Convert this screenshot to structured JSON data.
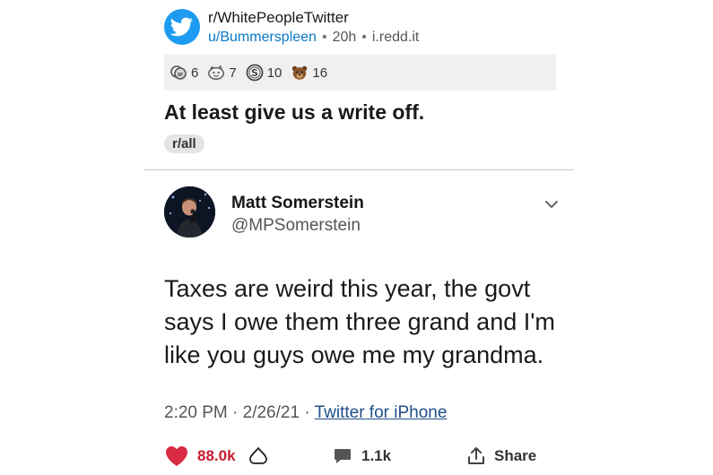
{
  "post": {
    "subreddit": "r/WhitePeopleTwitter",
    "user": "u/Bummerspleen",
    "age": "20h",
    "domain": "i.redd.it",
    "awards": [
      {
        "icon": "silver-award-icon",
        "count": "6"
      },
      {
        "icon": "wholesome-award-icon",
        "count": "7"
      },
      {
        "icon": "coin-award-icon",
        "count": "10"
      },
      {
        "icon": "bear-award-icon",
        "count": "16"
      }
    ],
    "title": "At least give us a write off.",
    "flair": "r/all"
  },
  "tweet": {
    "name": "Matt Somerstein",
    "handle": "@MPSomerstein",
    "text_lines": [
      "Taxes are weird this year, the govt",
      "says I owe them three grand and I'm",
      "like you guys owe me my grandma."
    ],
    "time": "2:20 PM · 2/26/21 · ",
    "source": "Twitter for iPhone",
    "likes": "88.0k",
    "comments": "1.1k",
    "share_label": "Share"
  },
  "colors": {
    "twitter_blue": "#1d9bf0",
    "like_red": "#c61a30",
    "link_blue": "#0a79c7",
    "award_bar_bg": "#f0f0f0"
  }
}
